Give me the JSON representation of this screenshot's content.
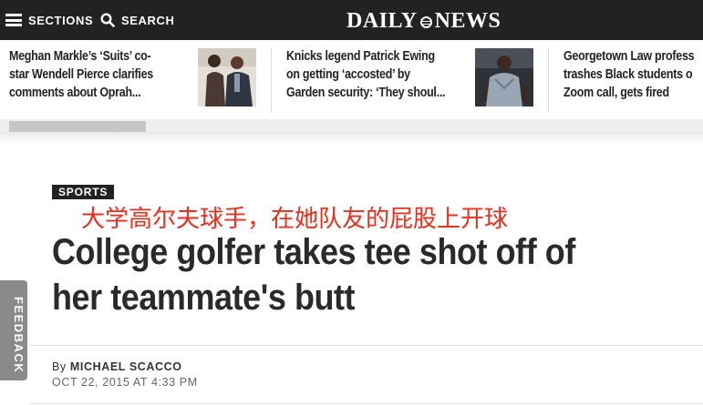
{
  "nav": {
    "sections_label": "SECTIONS",
    "search_label": "SEARCH",
    "logo_left": "DAILY",
    "logo_right": "NEWS"
  },
  "trending": [
    {
      "lines": [
        "Meghan Markle’s ‘Suits’ co-",
        "star Wendell Pierce clarifies",
        "comments about Oprah..."
      ]
    },
    {
      "lines": [
        "Knicks legend Patrick Ewing",
        "on getting ‘accosted’ by",
        "Garden security: ‘They shoul..."
      ]
    },
    {
      "lines": [
        "Georgetown Law profess",
        "trashes Black students o",
        "Zoom call, gets fired"
      ]
    }
  ],
  "article": {
    "section_tag": "SPORTS",
    "translation_caption": "大学高尔夫球手，在她队友的屁股上开球",
    "headline": "College golfer takes tee shot off of her teammate's butt",
    "byline_prefix": "By",
    "author": "MICHAEL SCACCO",
    "date": "OCT 22, 2015 AT 4:33 PM"
  },
  "feedback": {
    "label": "FEEDBACK"
  },
  "colors": {
    "topbar": "#222222",
    "caption_red": "#e8301f",
    "feedback_tab": "#8a8a8a"
  }
}
